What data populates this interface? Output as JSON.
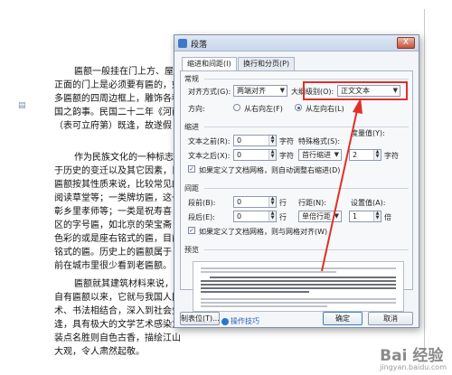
{
  "document": {
    "lines": [
      "匾额一般挂在门上方、屋檐",
      "正面的门上是必须要有匾的，如",
      "多匾额的四周边框上，雕饰各种",
      "国之韵事。民国二十二年《河南",
      "（表可立府第）既逢，故遂假",
      "作为民族文化的一种标志，",
      "于历史的变迁以及其它因素，目",
      "匾额按其性质来说，比较常见的",
      "阅读草堂等；一类牌坊匾，这一",
      "彰乡里孝师等；一类是祝寿喜",
      "区的字号匾，如北京的荣宝斋",
      "色彩的或是座右铭式的匾，目前",
      "铭式的匾。历史上的匾额属于",
      "前在城市里很少看到老匾额。",
      "匾额就其建筑材料来说，更",
      "自有匾额以来，它就与我国人民的社会生活密切相关。匾额是中国独特的民俗",
      "术、书法相结合，深入到社会生活的各个层面，人们在观赏中得到熏陶。匾额",
      "逢，具有极大的文学艺术感染力，一般有品位、典雅精美，同时又是中国建筑",
      "装点名胜则自色古香，描绘江山则雄伟壮观，装饰商店则生意兴隆，传播文化",
      "大观，令人肃然起敬。"
    ]
  },
  "dialog": {
    "title": "段落",
    "close_label": "X",
    "tabs": [
      "缩进和间距(I)",
      "换行和分页(P)"
    ],
    "general": {
      "section": "常规",
      "alignment_label": "对齐方式(G):",
      "alignment_value": "两端对齐",
      "outline_label": "大纲级别(O):",
      "outline_value": "正文文本",
      "direction_label": "方向:",
      "rtl_label": "从右向左(F)",
      "ltr_label": "从左向右(L)"
    },
    "indent": {
      "section": "缩进",
      "before_label": "文本之前(R):",
      "before_value": "0",
      "before_unit": "字符",
      "special_label": "特殊格式(S):",
      "special_value": "首行缩进",
      "measure_label": "度量值(Y):",
      "measure_value": "2",
      "measure_unit": "字符",
      "after_label": "文本之后(X):",
      "after_value": "0",
      "after_unit": "字符",
      "auto_adjust_label": "如果定义了文档网格，则自动调整右缩进(D)"
    },
    "spacing": {
      "section": "间距",
      "before_label": "段前(B):",
      "before_value": "0",
      "before_unit": "行",
      "line_label": "行距(N):",
      "line_value": "单倍行距",
      "setting_label": "设置值(A):",
      "setting_value": "1",
      "setting_unit": "倍",
      "after_label": "段后(E):",
      "after_value": "0",
      "after_unit": "行",
      "grid_label": "如果定义了文档网格，则与网格对齐(W)"
    },
    "preview": {
      "section": "预览"
    },
    "buttons": {
      "tabs": "制表位(T)...",
      "tips": "操作技巧",
      "ok": "确定",
      "cancel": "取消"
    }
  },
  "watermark": {
    "text": "Bai 经验",
    "sub": "jingyan.baidu.com"
  },
  "colors": {
    "annotation": "#e0302a",
    "accent": "#2b62b5"
  }
}
